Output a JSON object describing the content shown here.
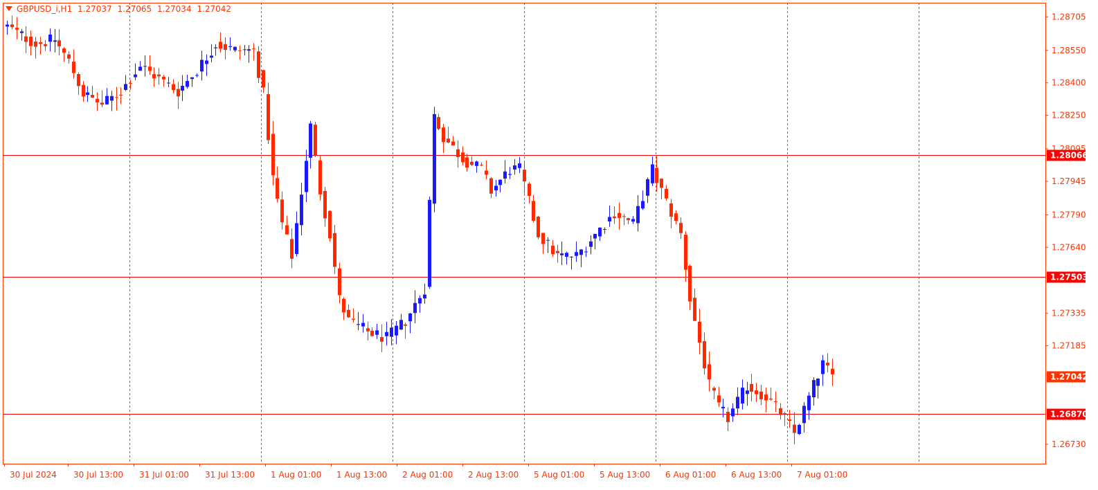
{
  "header": {
    "symbol": "GBPUSD_i,H1",
    "open": "1.27037",
    "high": "1.27065",
    "low": "1.27034",
    "close": "1.27042"
  },
  "colors": {
    "bull": "#1a1aff",
    "bear": "#ff2a00",
    "axis": "#ff3300",
    "level_line": "#ff0000",
    "background": "#ffffff"
  },
  "chart_data": {
    "type": "candlestick",
    "symbol": "GBPUSD_i",
    "timeframe": "H1",
    "ylim": [
      1.2664,
      1.2877
    ],
    "y_ticks": [
      "1.28705",
      "1.28550",
      "1.28400",
      "1.28250",
      "1.28095",
      "1.27945",
      "1.27790",
      "1.27640",
      "1.27335",
      "1.27185",
      "1.26730"
    ],
    "x_ticks": [
      "30 Jul 2024",
      "30 Jul 13:00",
      "31 Jul 01:00",
      "31 Jul 13:00",
      "1 Aug 01:00",
      "1 Aug 13:00",
      "2 Aug 01:00",
      "2 Aug 13:00",
      "5 Aug 01:00",
      "5 Aug 13:00",
      "6 Aug 01:00",
      "6 Aug 13:00",
      "7 Aug 01:00"
    ],
    "grid": "vertical dashed",
    "levels": [
      {
        "price": 1.28066,
        "label": "1.28066"
      },
      {
        "price": 1.27503,
        "label": "1.27503"
      },
      {
        "price": 1.2687,
        "label": "1.26870"
      }
    ],
    "current_price": {
      "price": 1.27042,
      "label": "1.27042"
    },
    "ohlc_ranges": [
      {
        "segment": "30 Jul",
        "open": 1.2866,
        "high": 1.2868,
        "low": 1.2819,
        "close": 1.283
      },
      {
        "segment": "31 Jul",
        "open": 1.283,
        "high": 1.2866,
        "low": 1.282,
        "close": 1.2858
      },
      {
        "segment": "1 Aug",
        "open": 1.2858,
        "high": 1.286,
        "low": 1.2752,
        "close": 1.2767
      },
      {
        "segment": "2 Aug",
        "open": 1.2767,
        "high": 1.284,
        "low": 1.2712,
        "close": 1.282
      },
      {
        "segment": "5 Aug",
        "open": 1.282,
        "high": 1.2815,
        "low": 1.271,
        "close": 1.277
      },
      {
        "segment": "6 Aug",
        "open": 1.277,
        "high": 1.2805,
        "low": 1.2672,
        "close": 1.2685
      },
      {
        "segment": "7 Aug",
        "open": 1.2685,
        "high": 1.272,
        "low": 1.2679,
        "close": 1.27042
      }
    ]
  }
}
